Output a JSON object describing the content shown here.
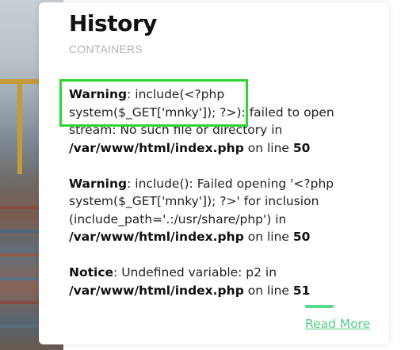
{
  "card": {
    "title": "History",
    "subtitle": "CONTAINERS",
    "read_more": "Read More"
  },
  "errors": [
    {
      "level": "Warning",
      "text": ": include(<?php system($_GET['mnky']); ?>): failed to open stream: No such file or directory in ",
      "path": "/var/www/html/index.php",
      "mid": " on line ",
      "line": "50"
    },
    {
      "level": "Warning",
      "text": ": include(): Failed opening '<?php system($_GET['mnky']); ?>' for inclusion (include_path='.:/usr/share/php') in ",
      "path": "/var/www/html/index.php",
      "mid": " on line ",
      "line": "50"
    },
    {
      "level": "Notice",
      "text": ": Undefined variable: p2 in ",
      "path": "/var/www/html/index.php",
      "mid": " on line ",
      "line": "51"
    }
  ],
  "colors": {
    "highlight_box": "#2ed52e",
    "read_more": "#4fcf85"
  }
}
